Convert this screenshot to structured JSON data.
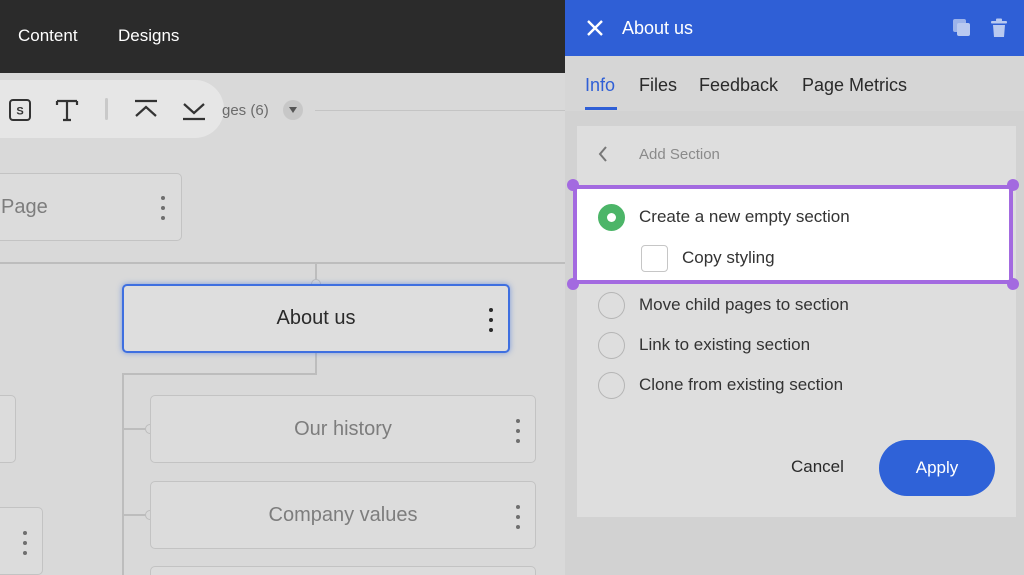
{
  "topbar": {
    "nav": [
      "Content",
      "Designs"
    ]
  },
  "toolbar": {
    "icons": [
      "section-icon",
      "text-icon",
      "collapse-up-icon",
      "collapse-down-icon"
    ],
    "section_glyph": "S",
    "text_glyph": "T",
    "pages_label": "ges (6)"
  },
  "tree": {
    "page_label": "Page",
    "selected_label": "About us",
    "children": [
      "Our history",
      "Company values"
    ]
  },
  "panel": {
    "title": "About us",
    "tabs": [
      "Info",
      "Files",
      "Feedback",
      "Page Metrics"
    ],
    "active_tab": "Info",
    "heading": "Add Section",
    "options": [
      {
        "label": "Create a new empty section",
        "selected": true
      },
      {
        "label": "Move child pages to section",
        "selected": false
      },
      {
        "label": "Link to existing section",
        "selected": false
      },
      {
        "label": "Clone from existing section",
        "selected": false
      }
    ],
    "copy_styling_label": "Copy styling",
    "copy_styling_checked": false,
    "cancel_label": "Cancel",
    "apply_label": "Apply"
  },
  "colors": {
    "accent": "#2f5fd6",
    "highlight": "#a36ae0",
    "radio_selected": "#4cb568",
    "topbar": "#2b2b2b"
  }
}
